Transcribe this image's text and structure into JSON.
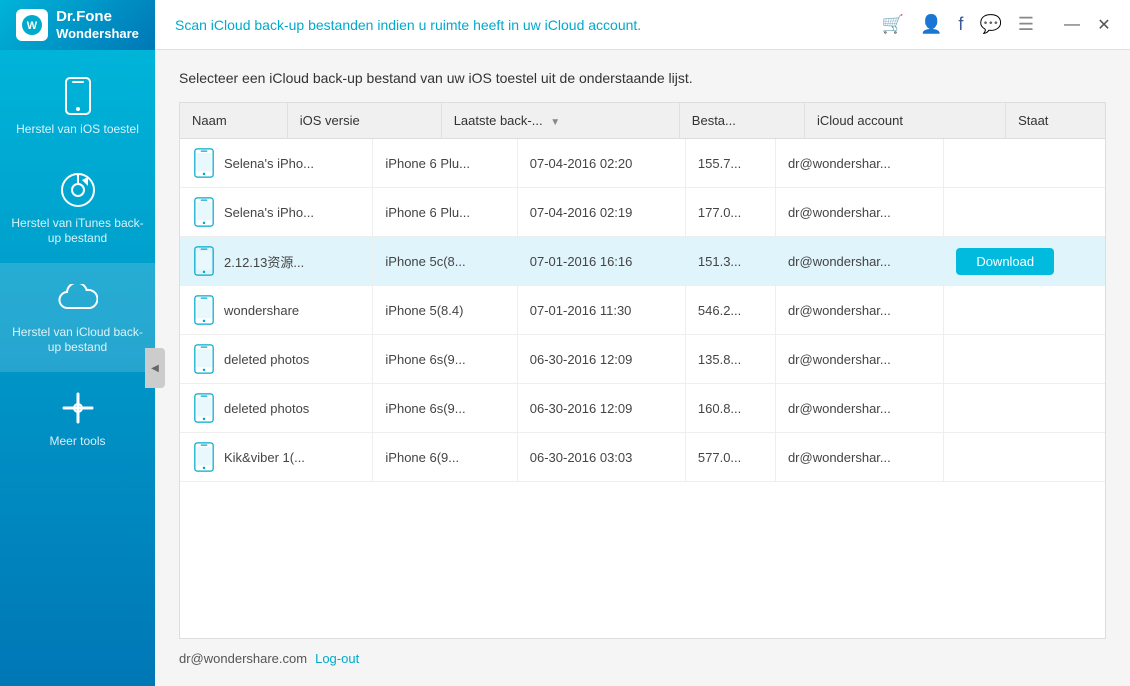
{
  "app": {
    "name": "Wondershare",
    "brand": "Dr.Fone",
    "header_message": "Scan iCloud back-up bestanden indien u ruimte heeft in uw iCloud account."
  },
  "titlebar": {
    "icons": [
      "cart",
      "profile",
      "facebook",
      "chat",
      "menu"
    ],
    "win_minimize": "—",
    "win_close": "✕"
  },
  "sidebar": {
    "items": [
      {
        "id": "ios-restore",
        "label": "Herstel van iOS toestel",
        "icon": "phone"
      },
      {
        "id": "itunes-restore",
        "label": "Herstel van iTunes back-up bestand",
        "icon": "itunes"
      },
      {
        "id": "icloud-restore",
        "label": "Herstel van iCloud back-up bestand",
        "icon": "cloud",
        "active": true
      },
      {
        "id": "more-tools",
        "label": "Meer tools",
        "icon": "tools"
      }
    ]
  },
  "content": {
    "subtitle": "Selecteer een iCloud back-up bestand van uw iOS toestel uit de onderstaande lijst.",
    "table": {
      "columns": [
        {
          "id": "naam",
          "label": "Naam",
          "width": "160"
        },
        {
          "id": "ios_versie",
          "label": "iOS versie",
          "width": "110"
        },
        {
          "id": "laatste_back",
          "label": "Laatste back-...",
          "width": "155",
          "sortable": true
        },
        {
          "id": "bestandsgrootte",
          "label": "Besta...",
          "width": "80"
        },
        {
          "id": "icloud_account",
          "label": "iCloud account",
          "width": "160"
        },
        {
          "id": "staat",
          "label": "Staat",
          "width": "120"
        }
      ],
      "rows": [
        {
          "id": 1,
          "naam": "Selena's iPho...",
          "ios_versie": "iPhone 6 Plu...",
          "laatste_back": "07-04-2016 02:20",
          "bestandsgrootte": "155.7...",
          "icloud_account": "dr@wondershar...",
          "staat": "",
          "selected": false
        },
        {
          "id": 2,
          "naam": "Selena's iPho...",
          "ios_versie": "iPhone 6 Plu...",
          "laatste_back": "07-04-2016 02:19",
          "bestandsgrootte": "177.0...",
          "icloud_account": "dr@wondershar...",
          "staat": "",
          "selected": false
        },
        {
          "id": 3,
          "naam": "2.12.13资源...",
          "ios_versie": "iPhone 5c(8...",
          "laatste_back": "07-01-2016 16:16",
          "bestandsgrootte": "151.3...",
          "icloud_account": "dr@wondershar...",
          "staat": "Download",
          "selected": true
        },
        {
          "id": 4,
          "naam": "wondershare",
          "ios_versie": "iPhone 5(8.4)",
          "laatste_back": "07-01-2016 11:30",
          "bestandsgrootte": "546.2...",
          "icloud_account": "dr@wondershar...",
          "staat": "",
          "selected": false
        },
        {
          "id": 5,
          "naam": "deleted photos",
          "ios_versie": "iPhone 6s(9...",
          "laatste_back": "06-30-2016 12:09",
          "bestandsgrootte": "135.8...",
          "icloud_account": "dr@wondershar...",
          "staat": "",
          "selected": false
        },
        {
          "id": 6,
          "naam": "deleted photos",
          "ios_versie": "iPhone 6s(9...",
          "laatste_back": "06-30-2016 12:09",
          "bestandsgrootte": "160.8...",
          "icloud_account": "dr@wondershar...",
          "staat": "",
          "selected": false
        },
        {
          "id": 7,
          "naam": "Kik&viber 1(...",
          "ios_versie": "iPhone 6(9...",
          "laatste_back": "06-30-2016 03:03",
          "bestandsgrootte": "577.0...",
          "icloud_account": "dr@wondershar...",
          "staat": "",
          "selected": false
        }
      ]
    },
    "footer": {
      "account": "dr@wondershare.com",
      "logout_label": "Log-out"
    }
  }
}
